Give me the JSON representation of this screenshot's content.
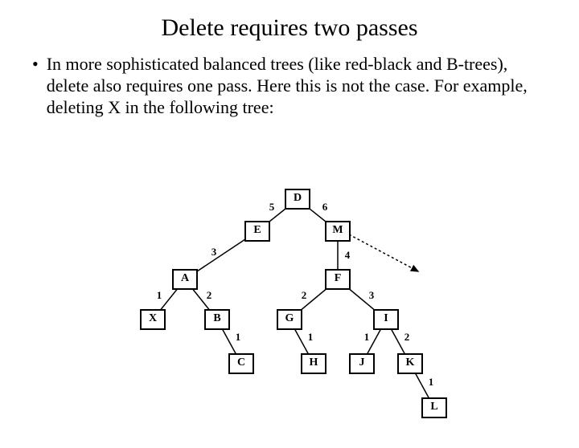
{
  "title": "Delete requires two passes",
  "bullet": "In more sophisticated balanced trees (like red-black and B-trees), delete also requires one pass. Here this is not the case. For example, deleting X in the following tree:",
  "nodes": {
    "D": "D",
    "E": "E",
    "M": "M",
    "A": "A",
    "F": "F",
    "X": "X",
    "B": "B",
    "G": "G",
    "I": "I",
    "C": "C",
    "H": "H",
    "J": "J",
    "K": "K",
    "L": "L"
  },
  "edge_labels": {
    "D_E": "5",
    "D_M": "6",
    "E_A": "3",
    "M_F": "4",
    "A_X": "1",
    "A_B": "2",
    "F_G": "2",
    "F_I": "3",
    "B_C": "1",
    "G_H": "1",
    "I_J": "1",
    "I_K": "2",
    "K_L": "1"
  },
  "chart_data": {
    "type": "tree",
    "title": "Example balanced tree for delete-X illustration",
    "nodes": [
      "D",
      "E",
      "M",
      "A",
      "F",
      "X",
      "B",
      "G",
      "I",
      "C",
      "H",
      "J",
      "K",
      "L"
    ],
    "edges": [
      {
        "from": "D",
        "to": "E",
        "weight": 5
      },
      {
        "from": "D",
        "to": "M",
        "weight": 6
      },
      {
        "from": "E",
        "to": "A",
        "weight": 3
      },
      {
        "from": "M",
        "to": "F",
        "weight": 4
      },
      {
        "from": "A",
        "to": "X",
        "weight": 1
      },
      {
        "from": "A",
        "to": "B",
        "weight": 2
      },
      {
        "from": "F",
        "to": "G",
        "weight": 2
      },
      {
        "from": "F",
        "to": "I",
        "weight": 3
      },
      {
        "from": "B",
        "to": "C",
        "weight": 1
      },
      {
        "from": "G",
        "to": "H",
        "weight": 1
      },
      {
        "from": "I",
        "to": "J",
        "weight": 1
      },
      {
        "from": "I",
        "to": "K",
        "weight": 2
      },
      {
        "from": "K",
        "to": "L",
        "weight": 1
      }
    ],
    "dashed_arrow_from": "M"
  }
}
